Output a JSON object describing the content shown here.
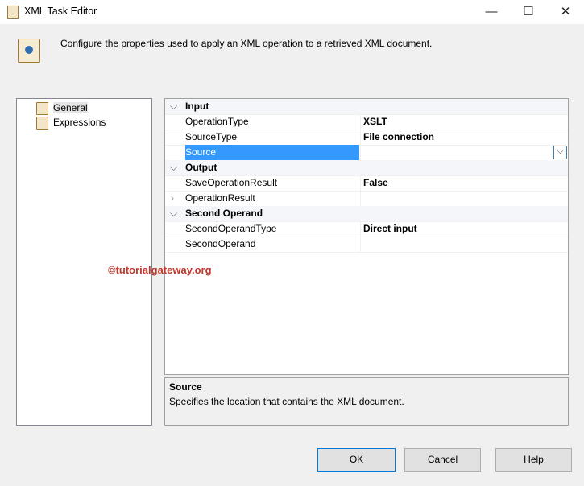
{
  "window": {
    "title": "XML Task Editor",
    "minimize": "—",
    "maximize": "☐",
    "close": "✕"
  },
  "description": "Configure the properties used to apply an XML operation to a retrieved XML document.",
  "nav": [
    "General",
    "Expressions"
  ],
  "grid": {
    "input": {
      "label": "Input",
      "rows": [
        {
          "name": "OperationType",
          "value": "XSLT"
        },
        {
          "name": "SourceType",
          "value": "File connection"
        },
        {
          "name": "Source",
          "value": ""
        }
      ]
    },
    "output": {
      "label": "Output",
      "rows": [
        {
          "name": "SaveOperationResult",
          "value": "False"
        },
        {
          "name": "OperationResult",
          "value": ""
        }
      ]
    },
    "second": {
      "label": "Second Operand",
      "rows": [
        {
          "name": "SecondOperandType",
          "value": "Direct input"
        },
        {
          "name": "SecondOperand",
          "value": ""
        }
      ]
    }
  },
  "watermark": "©tutorialgateway.org",
  "help": {
    "title": "Source",
    "text": "Specifies the location that contains the XML document."
  },
  "buttons": {
    "ok": "OK",
    "cancel": "Cancel",
    "help": "Help"
  }
}
